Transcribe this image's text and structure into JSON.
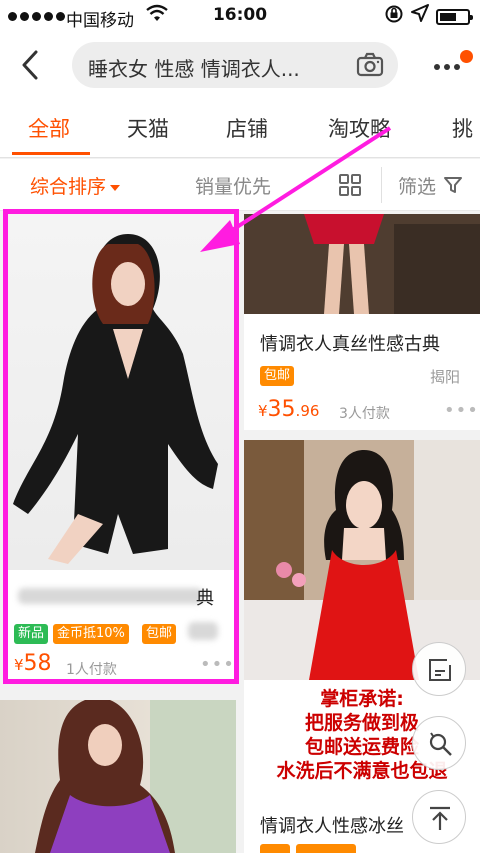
{
  "status_bar": {
    "carrier": "中国移动",
    "time": "16:00"
  },
  "search": {
    "query": "睡衣女 性感 情调衣人..."
  },
  "tabs": [
    "全部",
    "天猫",
    "店铺",
    "淘攻略",
    "挑"
  ],
  "sort": {
    "comprehensive": "综合排序",
    "sales_first": "销量优先",
    "filter": "筛选"
  },
  "products": [
    {
      "title_visible": "典",
      "badges": [
        "新品",
        "金币抵10%",
        "包邮"
      ],
      "currency": "¥",
      "price_int": "58",
      "price_dec": "",
      "sales": "1人付款"
    },
    {
      "title": "情调衣人真丝性感古典",
      "badges": [
        "包邮"
      ],
      "location": "揭阳",
      "currency": "¥",
      "price_int": "35",
      "price_dec": ".96",
      "sales": "3人付款"
    },
    {
      "promise_lines": [
        "掌柜承诺:",
        "把服务做到极",
        "包邮送运费险",
        "水洗后不满意也包退"
      ],
      "title": "情调衣人性感冰丝"
    }
  ],
  "colors": {
    "accent": "#ff5000",
    "highlight": "#ff1ce0",
    "badge_green": "#2dbb55",
    "badge_orange": "#ff8a00"
  }
}
